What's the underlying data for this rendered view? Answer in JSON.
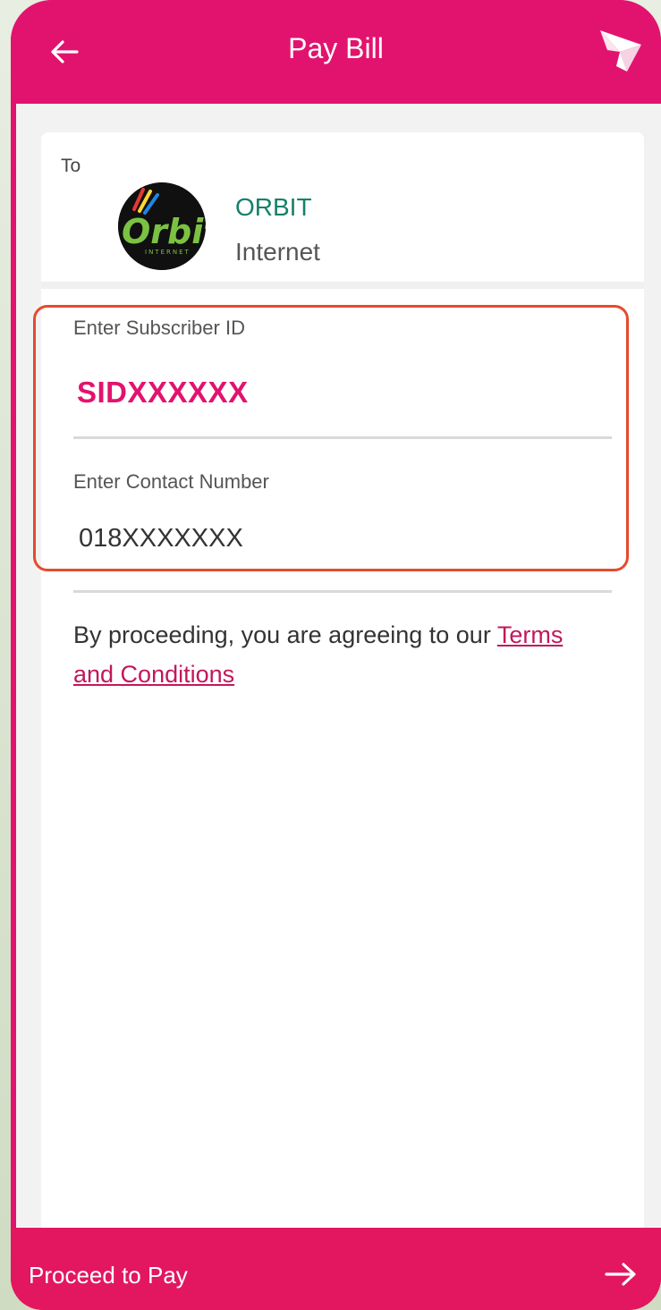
{
  "header": {
    "title": "Pay Bill",
    "back_icon": "arrow-left-icon",
    "brand_icon": "paper-bird-logo-icon"
  },
  "recipient": {
    "to_label": "To",
    "name": "ORBIT",
    "category": "Internet",
    "logo_text": "Orbit"
  },
  "form": {
    "subscriber_label": "Enter Subscriber ID",
    "subscriber_value": "SIDXXXXXX",
    "contact_label": "Enter Contact Number",
    "contact_value": "018XXXXXXX"
  },
  "terms": {
    "prefix": "By proceeding, you are agreeing to our ",
    "link": "Terms and Conditions"
  },
  "footer": {
    "proceed_label": "Proceed to Pay",
    "arrow_icon": "arrow-right-icon"
  },
  "colors": {
    "brand": "#e2136e",
    "biller_name": "#16806b",
    "highlight_border": "#e64a2e"
  }
}
